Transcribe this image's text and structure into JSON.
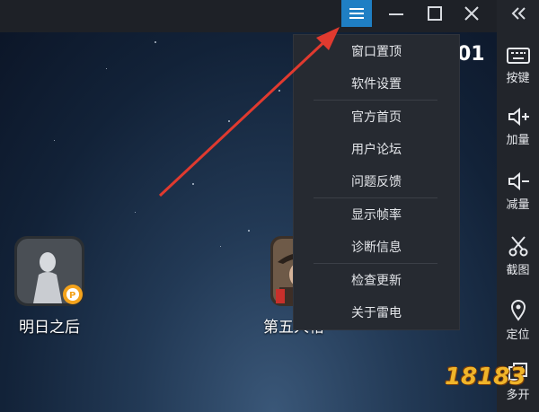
{
  "titlebar": {
    "menu_icon": "hamburger-icon",
    "minimize_icon": "minimize-icon",
    "maximize_icon": "maximize-icon",
    "close_icon": "close-icon"
  },
  "sidebar": {
    "collapse_icon": "double-chevron-left-icon",
    "items": [
      {
        "label": "按键",
        "icon": "keyboard-icon"
      },
      {
        "label": "加量",
        "icon": "volume-up-icon"
      },
      {
        "label": "减量",
        "icon": "volume-down-icon"
      },
      {
        "label": "截图",
        "icon": "scissors-icon"
      },
      {
        "label": "定位",
        "icon": "location-pin-icon"
      },
      {
        "label": "多开",
        "icon": "multi-window-icon"
      }
    ]
  },
  "menu": {
    "items": [
      "窗口置顶",
      "软件设置",
      "官方首页",
      "用户论坛",
      "问题反馈",
      "显示帧率",
      "诊断信息",
      "检查更新",
      "关于雷电"
    ]
  },
  "desktop": {
    "apps": [
      {
        "label": "明日之后",
        "icon": "game-icon-mingrizhihou"
      },
      {
        "label": "第五人格",
        "icon": "game-icon-diwurenge"
      }
    ],
    "clock_partial": "01"
  },
  "watermark": "18183",
  "colors": {
    "menu_button_active": "#1f7fc4",
    "arrow": "#e03a2f",
    "menu_bg": "#262a31",
    "sidebar_bg": "#22252b"
  }
}
